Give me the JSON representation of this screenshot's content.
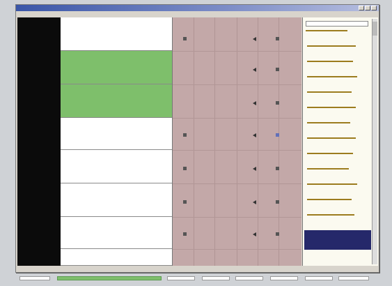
{
  "window": {
    "title": "",
    "caption": ""
  },
  "menu": [],
  "times": [],
  "cues": [],
  "panel": {
    "dropdown": "",
    "items": [],
    "selected": ""
  },
  "status": [],
  "colors": {
    "time_column": "#0b0b0b",
    "cue_highlight": "#7ebf6b",
    "grid": "#c3a8a8",
    "panel_bg": "#fbfaf0",
    "selected_item": "#25286a",
    "titlebar": "#3a56a8"
  }
}
